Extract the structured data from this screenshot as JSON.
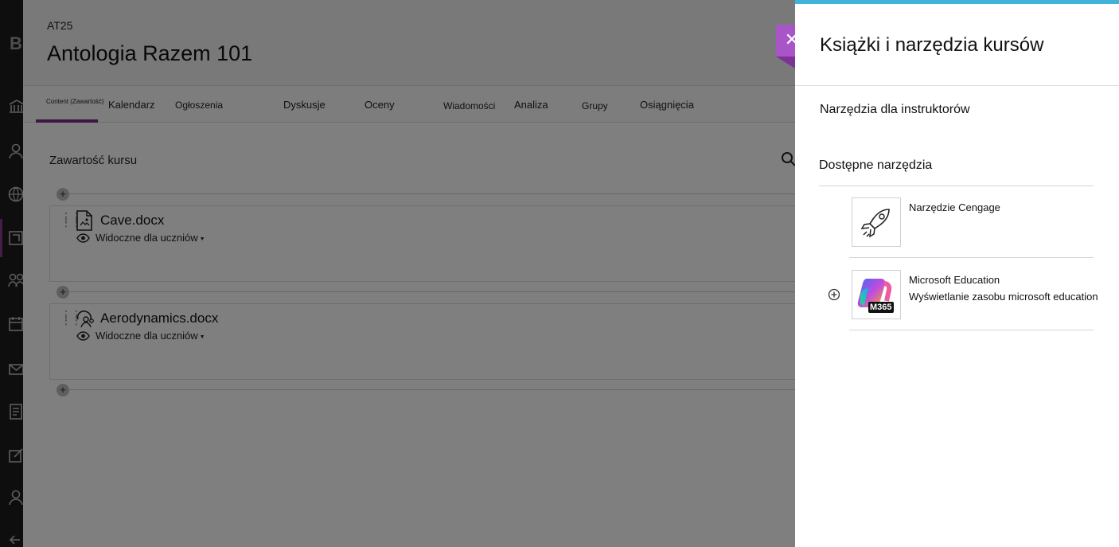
{
  "course": {
    "code": "AT25",
    "title": "Antologia Razem 101",
    "tabs": [
      {
        "label": "Content (Zawartość)"
      },
      {
        "label": "Kalendarz"
      },
      {
        "label": "Ogłoszenia"
      },
      {
        "label": "Dyskusje"
      },
      {
        "label": "Oceny"
      },
      {
        "label": "Wiadomości"
      },
      {
        "label": "Analiza"
      },
      {
        "label": "Grupy"
      },
      {
        "label": "Osiągnięcia"
      }
    ],
    "active_tab": 0,
    "content_title": "Zawartość kursu",
    "items": [
      {
        "name": "Cave.docx",
        "visibility": "Widoczne dla uczniów",
        "icon": "document-icon"
      },
      {
        "name": "Aerodynamics.docx",
        "visibility": "Widoczne dla uczniów",
        "icon": "group-document-icon"
      }
    ]
  },
  "leftnav": {
    "logo": "B",
    "icons": [
      "institution-icon",
      "profile-icon",
      "globe-icon",
      "courses-icon",
      "organizations-icon",
      "calendar-icon",
      "messages-icon",
      "grades-icon",
      "edit-icon",
      "user-icon",
      "signout-icon"
    ]
  },
  "panel": {
    "title": "Książki i narzędzia kursów",
    "instructor_tools_link": "Narzędzia dla instruktorów",
    "available_tools_title": "Dostępne narzędzia",
    "tools": [
      {
        "name": "Narzędzie Cengage",
        "description": "",
        "icon": "rocket-icon"
      },
      {
        "name": "Microsoft Education",
        "description": "Wyświetlanie zasobu microsoft education",
        "icon": "m365-icon",
        "badge": "M365"
      }
    ]
  },
  "colors": {
    "accent_purple": "#7b2c83",
    "close_tab": "#a855c7",
    "panel_top_bar": "#3fb4d8"
  }
}
